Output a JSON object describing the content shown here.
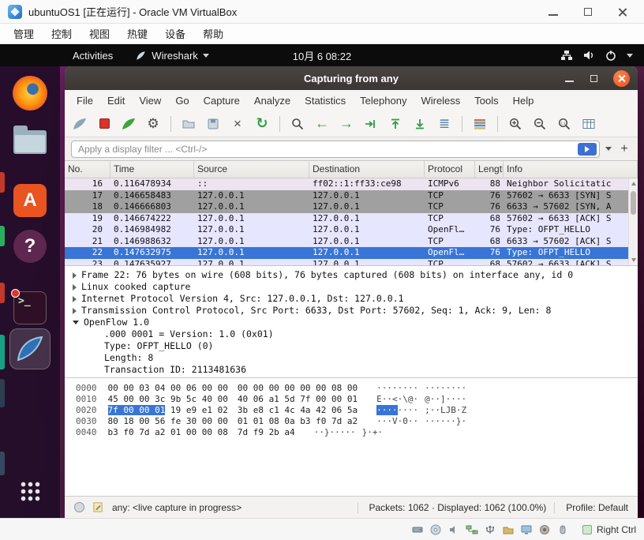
{
  "colors": {
    "selection_blue": "#3875d7",
    "close_button_orange": "#e9541f",
    "tcp_row_lavender": "#e7e6ff",
    "syn_row_gray": "#a0a0a0",
    "icmp_row": "#ece4f0",
    "hex_highlight_blue": "#3875d7",
    "ubuntu_purple": "#5e2750",
    "panel_black": "#0c0c0c",
    "toolbar_green": "#2f9e44"
  },
  "icons": {
    "gear": "⚙",
    "close_x": "×",
    "reload": "↻",
    "arrow_left": "←",
    "arrow_right": "→",
    "scroll_lines": "≣"
  },
  "vbox": {
    "title": "ubuntuOS1 [正在运行] - Oracle VM VirtualBox",
    "menu": [
      {
        "label": "管理"
      },
      {
        "label": "控制"
      },
      {
        "label": "视图"
      },
      {
        "label": "热键"
      },
      {
        "label": "设备"
      },
      {
        "label": "帮助"
      }
    ],
    "host_key": "Right Ctrl"
  },
  "panel": {
    "activities": "Activities",
    "app_name": "Wireshark",
    "clock": "10月 6 08:22"
  },
  "ws": {
    "title": "Capturing from any",
    "menu": [
      {
        "label": "File"
      },
      {
        "label": "Edit"
      },
      {
        "label": "View"
      },
      {
        "label": "Go"
      },
      {
        "label": "Capture"
      },
      {
        "label": "Analyze"
      },
      {
        "label": "Statistics"
      },
      {
        "label": "Telephony"
      },
      {
        "label": "Wireless"
      },
      {
        "label": "Tools"
      },
      {
        "label": "Help"
      }
    ],
    "filter": {
      "placeholder": "Apply a display filter ... <Ctrl-/>",
      "add_label": "+"
    },
    "cols": [
      {
        "label": "No."
      },
      {
        "label": "Time"
      },
      {
        "label": "Source"
      },
      {
        "label": "Destination"
      },
      {
        "label": "Protocol"
      },
      {
        "label": "Length"
      },
      {
        "label": "Info"
      }
    ],
    "rows": [
      {
        "no": "16",
        "time": "0.116478934",
        "src": "::",
        "dst": "ff02::1:ff33:ce98",
        "proto": "ICMPv6",
        "len": "88",
        "info": "Neighbor Solicitatic"
      },
      {
        "no": "17",
        "time": "0.146658483",
        "src": "127.0.0.1",
        "dst": "127.0.0.1",
        "proto": "TCP",
        "len": "76",
        "info": "57602 → 6633 [SYN] S"
      },
      {
        "no": "18",
        "time": "0.146666803",
        "src": "127.0.0.1",
        "dst": "127.0.0.1",
        "proto": "TCP",
        "len": "76",
        "info": "6633 → 57602 [SYN, A"
      },
      {
        "no": "19",
        "time": "0.146674222",
        "src": "127.0.0.1",
        "dst": "127.0.0.1",
        "proto": "TCP",
        "len": "68",
        "info": "57602 → 6633 [ACK] S"
      },
      {
        "no": "20",
        "time": "0.146984982",
        "src": "127.0.0.1",
        "dst": "127.0.0.1",
        "proto": "OpenFl…",
        "len": "76",
        "info": "Type: OFPT_HELLO"
      },
      {
        "no": "21",
        "time": "0.146988632",
        "src": "127.0.0.1",
        "dst": "127.0.0.1",
        "proto": "TCP",
        "len": "68",
        "info": "6633 → 57602 [ACK] S"
      },
      {
        "no": "22",
        "time": "0.147632975",
        "src": "127.0.0.1",
        "dst": "127.0.0.1",
        "proto": "OpenFl…",
        "len": "76",
        "info": "Type: OFPT_HELLO"
      },
      {
        "no": "23",
        "time": "0.147635927",
        "src": "127.0.0.1",
        "dst": "127.0.0.1",
        "proto": "TCP",
        "len": "68",
        "info": "57602 → 6633 [ACK] S"
      }
    ],
    "details": [
      {
        "text": "Frame 22: 76 bytes on wire (608 bits), 76 bytes captured (608 bits) on interface any, id 0"
      },
      {
        "text": "Linux cooked capture"
      },
      {
        "text": "Internet Protocol Version 4, Src: 127.0.0.1, Dst: 127.0.0.1"
      },
      {
        "text": "Transmission Control Protocol, Src Port: 6633, Dst Port: 57602, Seq: 1, Ack: 9, Len: 8"
      },
      {
        "text": "OpenFlow 1.0"
      },
      {
        "text": ".000 0001 = Version: 1.0 (0x01)"
      },
      {
        "text": "Type: OFPT_HELLO (0)"
      },
      {
        "text": "Length: 8"
      },
      {
        "text": "Transaction ID: 2113481636"
      }
    ],
    "hex": {
      "rows": [
        {
          "off": "0000",
          "h1": "00 00 03 04 00 06 00 00",
          "h2": "00 00 00 00 00 00 08 00",
          "a1": "········",
          "a2": "········"
        },
        {
          "off": "0010",
          "h1": "45 00 00 3c 9b 5c 40 00",
          "h2": "40 06 a1 5d 7f 00 00 01",
          "a1": "E··<·\\@·",
          "a2": "@··]····"
        },
        {
          "off": "0020",
          "hl": "7f 00 00 01",
          "h1": " 19 e9 e1 02",
          "h2": "3b e8 c1 4c 4a 42 06 5a",
          "ahl": "····",
          "a1": "····",
          "a2": ";··LJB·Z"
        },
        {
          "off": "0030",
          "h1": "80 18 00 56 fe 30 00 00",
          "h2": "01 01 08 0a b3 f0 7d a2",
          "a1": "···V·0··",
          "a2": "······}·"
        },
        {
          "off": "0040",
          "h1": "b3 f0 7d a2 01 00 00 08",
          "h2": "7d f9 2b a4",
          "a1": "··}·····",
          "a2": "}·+·"
        }
      ]
    },
    "status": {
      "capture": "any: <live capture in progress>",
      "packets": "Packets: 1062 · Displayed: 1062 (100.0%)",
      "profile": "Profile: Default"
    }
  }
}
